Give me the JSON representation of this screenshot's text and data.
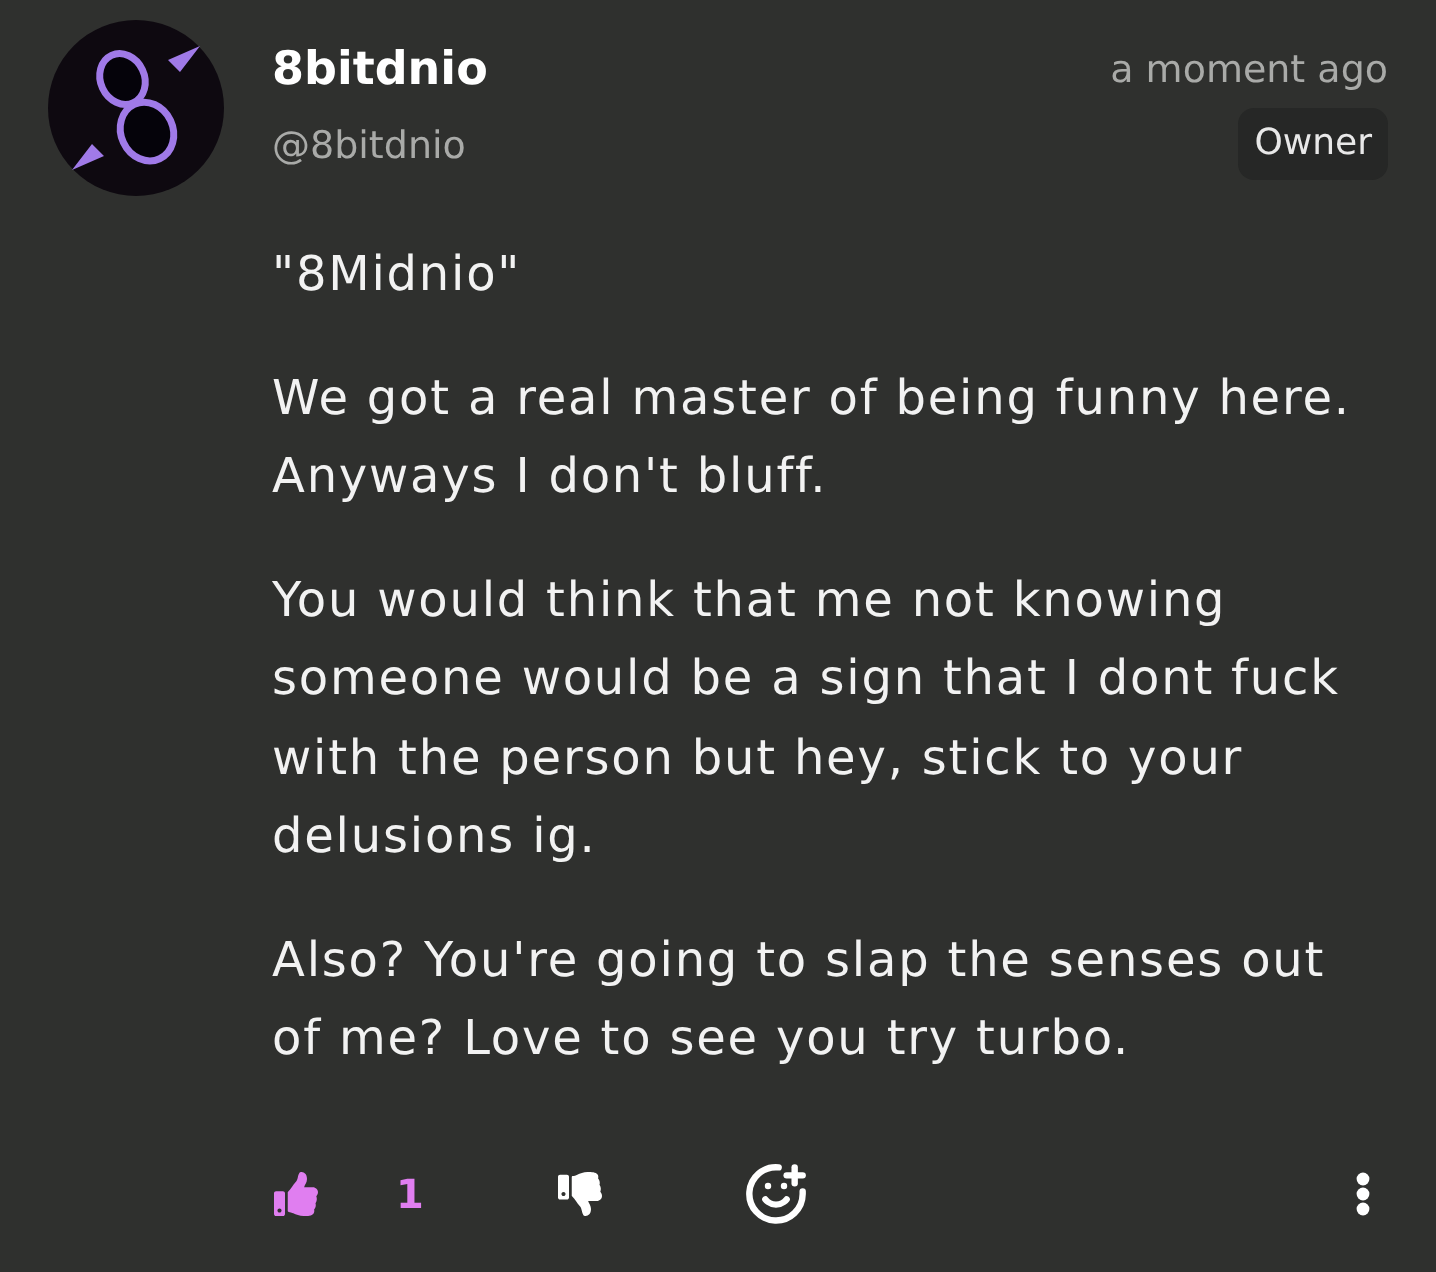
{
  "comment": {
    "author": {
      "name": "8bitdnio",
      "handle": "@8bitdnio"
    },
    "timestamp": "a moment ago",
    "badge": "Owner",
    "paragraphs": [
      "\"8Midnio\"",
      "We got a real master of being funny here. Anyways I don't bluff.",
      "You would think that me not knowing someone would be a sign that I dont fuck with the person but hey, stick to your delusions ig.",
      "Also? You're going to slap the senses out of me? Love to see you try turbo."
    ],
    "actions": {
      "like": {
        "count": "1",
        "selected": true
      },
      "dislike": {
        "selected": false
      }
    }
  }
}
